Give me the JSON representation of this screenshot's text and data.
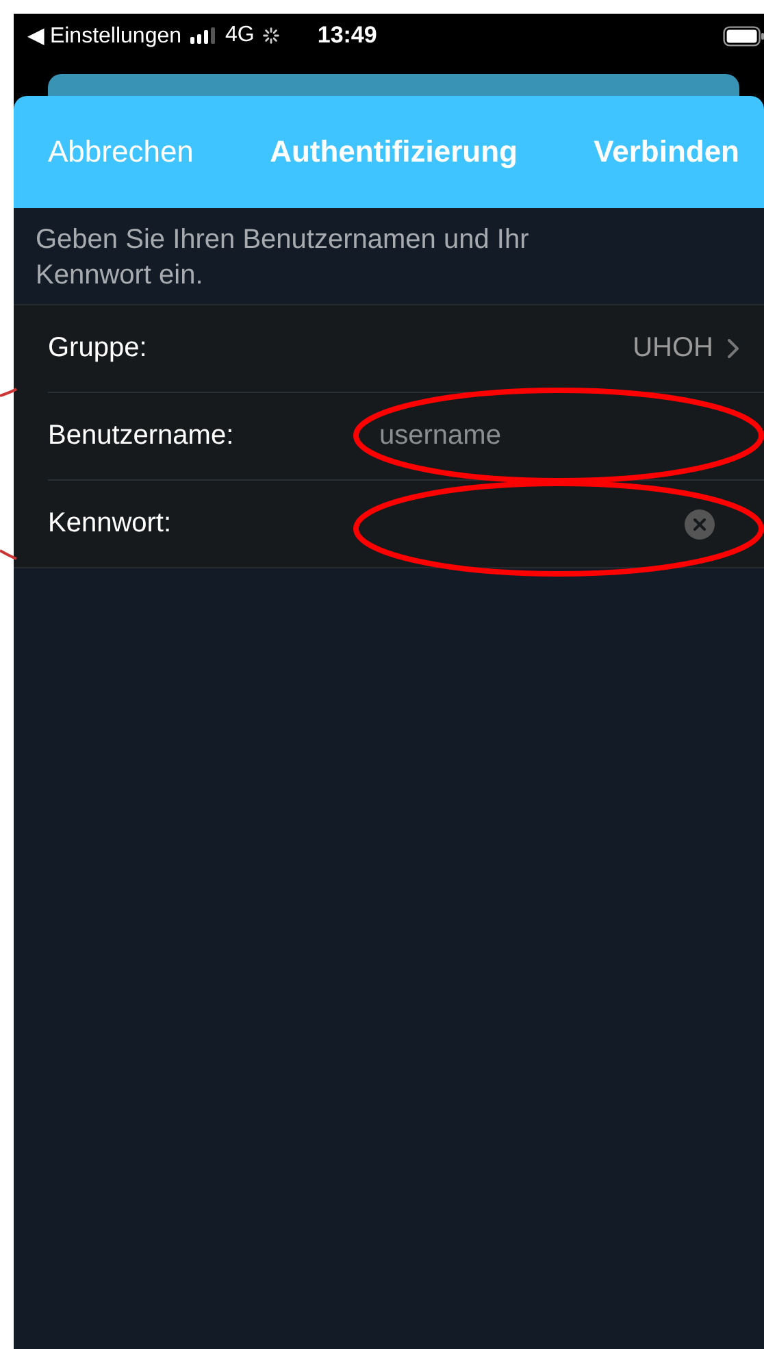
{
  "status_bar": {
    "back_glyph": "◀",
    "back_label": "Einstellungen",
    "network": "4G",
    "time": "13:49"
  },
  "header": {
    "cancel": "Abbrechen",
    "title": "Authentifizierung",
    "connect": "Verbinden"
  },
  "instruction": "Geben Sie Ihren Benutzernamen und Ihr Kennwort ein.",
  "rows": [
    {
      "kind": "link",
      "label": "Gruppe:",
      "value": "UHOH"
    },
    {
      "kind": "text",
      "label": "Benutzername:",
      "placeholder": "username"
    },
    {
      "kind": "password",
      "label": "Kennwort:",
      "clear_button": true
    }
  ],
  "annotations": [
    {
      "kind": "ellipse"
    },
    {
      "kind": "ellipse"
    },
    {
      "kind": "arc"
    }
  ]
}
